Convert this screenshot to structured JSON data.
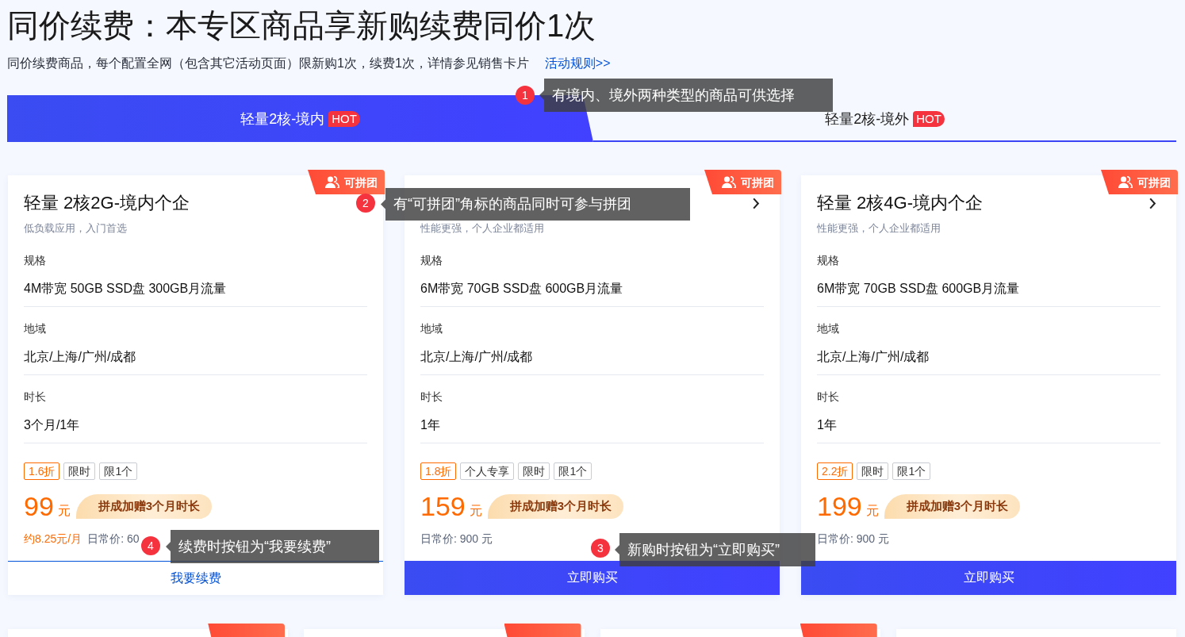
{
  "header": {
    "title": "同价续费：本专区商品享新购续费同价1次",
    "description": "同价续费商品，每个配置全网（包含其它活动页面）限新购1次，续费1次，详情参见销售卡片",
    "rules_link": "活动规则>>"
  },
  "tabs": [
    {
      "label": "轻量2核-境内",
      "badge": "HOT",
      "selected": true
    },
    {
      "label": "轻量2核-境外",
      "badge": "HOT",
      "selected": false
    }
  ],
  "products": [
    {
      "badge": "可拼团",
      "title": "轻量 2核2G-境内个企",
      "details_arrow": false,
      "subtitle": "低负载应用，入门首选",
      "specs": [
        {
          "label": "规格",
          "value": "4M带宽 50GB SSD盘 300GB月流量"
        },
        {
          "label": "地域",
          "value": "北京/上海/广州/成都"
        },
        {
          "label": "时长",
          "value": "3个月/1年"
        }
      ],
      "tags": [
        {
          "kind": "discount",
          "text": "1.6折"
        },
        {
          "kind": "plain",
          "text": "限时"
        },
        {
          "kind": "plain",
          "text": "限1个"
        }
      ],
      "price": "99",
      "currency": "元",
      "promo": "拼成加赠3个月时长",
      "monthly_price": "约8.25元/月",
      "regular_price": "日常价: 60",
      "button": {
        "kind": "renew",
        "label": "我要续费"
      }
    },
    {
      "badge": "可拼团",
      "details_arrow": true,
      "subtitle": "性能更强，个人企业都适用",
      "specs": [
        {
          "label": "规格",
          "value": "6M带宽 70GB SSD盘 600GB月流量"
        },
        {
          "label": "地域",
          "value": "北京/上海/广州/成都"
        },
        {
          "label": "时长",
          "value": "1年"
        }
      ],
      "tags": [
        {
          "kind": "discount",
          "text": "1.8折"
        },
        {
          "kind": "plain",
          "text": "个人专享"
        },
        {
          "kind": "plain",
          "text": "限时"
        },
        {
          "kind": "plain",
          "text": "限1个"
        }
      ],
      "price": "159",
      "currency": "元",
      "promo": "拼成加赠3个月时长",
      "regular_price": "日常价: 900 元",
      "button": {
        "kind": "buy",
        "label": "立即购买"
      }
    },
    {
      "badge": "可拼团",
      "title": "轻量 2核4G-境内个企",
      "details_arrow": true,
      "subtitle": "性能更强，个人企业都适用",
      "specs": [
        {
          "label": "规格",
          "value": "6M带宽 70GB SSD盘 600GB月流量"
        },
        {
          "label": "地域",
          "value": "北京/上海/广州/成都"
        },
        {
          "label": "时长",
          "value": "1年"
        }
      ],
      "tags": [
        {
          "kind": "discount",
          "text": "2.2折"
        },
        {
          "kind": "plain",
          "text": "限时"
        },
        {
          "kind": "plain",
          "text": "限1个"
        }
      ],
      "price": "199",
      "currency": "元",
      "promo": "拼成加赠3个月时长",
      "regular_price": "日常价: 900 元",
      "button": {
        "kind": "buy",
        "label": "立即购买"
      }
    }
  ],
  "more_products": [
    {
      "group_buy": true
    },
    {
      "group_buy": true
    },
    {
      "group_buy": true
    },
    {
      "group_buy": false
    }
  ],
  "annotations": [
    {
      "number": "1",
      "text": "有境内、境外两种类型的商品可供选择"
    },
    {
      "number": "2",
      "text": "有“可拼团”角标的商品同时可参与拼团"
    },
    {
      "number": "4",
      "text": "续费时按钮为“我要续费”"
    },
    {
      "number": "3",
      "text": "新购时按钮为“立即购买”"
    }
  ]
}
